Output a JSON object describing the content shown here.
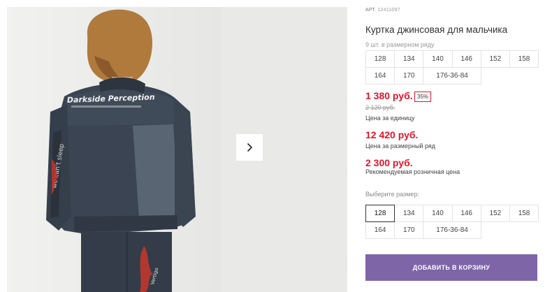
{
  "gallery": {
    "next_icon": "chevron-right-icon"
  },
  "product": {
    "article_label": "АРТ.",
    "article_value": "12411097",
    "title": "Куртка джинсовая для мальчика",
    "pieces_label": "9 шт. в размерном ряду",
    "row_sizes": [
      "128",
      "134",
      "140",
      "146",
      "152",
      "158",
      "164",
      "170",
      "176-36-84"
    ],
    "price_unit": "1 380 руб.",
    "discount": "35%",
    "price_old": "2 120 руб.",
    "price_unit_caption": "Цена за единицу",
    "price_row": "12 420 руб.",
    "price_row_caption": "Цена за размерный ряд",
    "price_rrp": "2 300 руб.",
    "price_rrp_caption": "Рекомендуемая розничная цена",
    "choose_label": "Выберите размер:",
    "choose_sizes": [
      "128",
      "134",
      "140",
      "146",
      "152",
      "158",
      "164",
      "170",
      "176-36-84"
    ],
    "selected_size": "128",
    "add_to_cart": "ДОБАВИТЬ В КОРЗИНУ"
  },
  "colors": {
    "price_red": "#e0162b",
    "button_purple": "#7e65a8"
  }
}
